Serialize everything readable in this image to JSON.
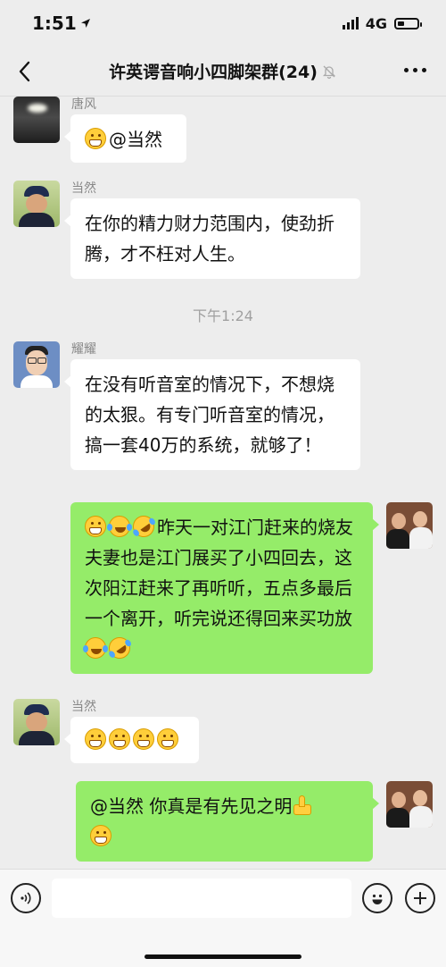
{
  "status_bar": {
    "time": "1:51",
    "network": "4G",
    "battery_level": 0.35
  },
  "header": {
    "title": "许英谔音响小四脚架群(24)"
  },
  "messages": [
    {
      "sender": "唐风",
      "text": "@当然"
    },
    {
      "sender": "当然",
      "text": "在你的精力财力范围内，使劲折腾，才不枉对人生。"
    },
    {
      "timestamp": "下午1:24"
    },
    {
      "sender": "耀耀",
      "text": "在没有听音室的情况下，不想烧的太狠。有专门听音室的情况，搞一套40万的系统，就够了！"
    },
    {
      "self": true,
      "text": "昨天一对江门赶来的烧友夫妻也是江门展买了小四回去，这次阳江赶来了再听听，五点多最后一个离开，听完说还得回来买功放"
    },
    {
      "sender": "当然",
      "emojis": [
        "grin",
        "grin",
        "grin",
        "grin"
      ]
    },
    {
      "self": true,
      "text": "@当然 你真是有先见之明"
    }
  ],
  "icons": {
    "back": "chevron-left-icon",
    "mute": "bell-off-icon",
    "more": "more-dots-icon",
    "voice": "voice-icon",
    "emoji": "emoji-icon",
    "plus": "plus-icon"
  },
  "colors": {
    "self_bubble": "#95ec69",
    "other_bubble": "#ffffff",
    "background": "#ededed"
  }
}
